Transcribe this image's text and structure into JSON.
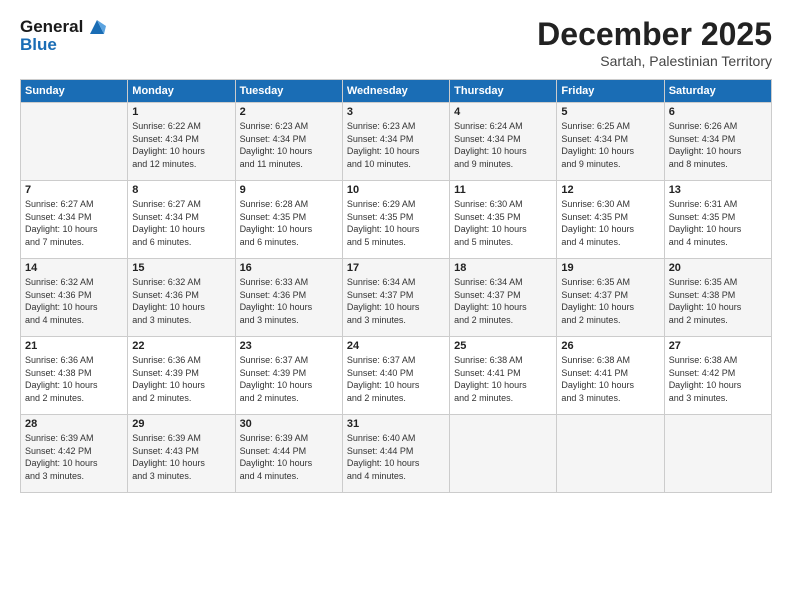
{
  "logo": {
    "line1": "General",
    "line2": "Blue"
  },
  "title": "December 2025",
  "subtitle": "Sartah, Palestinian Territory",
  "days_of_week": [
    "Sunday",
    "Monday",
    "Tuesday",
    "Wednesday",
    "Thursday",
    "Friday",
    "Saturday"
  ],
  "weeks": [
    [
      {
        "day": "",
        "info": ""
      },
      {
        "day": "1",
        "info": "Sunrise: 6:22 AM\nSunset: 4:34 PM\nDaylight: 10 hours\nand 12 minutes."
      },
      {
        "day": "2",
        "info": "Sunrise: 6:23 AM\nSunset: 4:34 PM\nDaylight: 10 hours\nand 11 minutes."
      },
      {
        "day": "3",
        "info": "Sunrise: 6:23 AM\nSunset: 4:34 PM\nDaylight: 10 hours\nand 10 minutes."
      },
      {
        "day": "4",
        "info": "Sunrise: 6:24 AM\nSunset: 4:34 PM\nDaylight: 10 hours\nand 9 minutes."
      },
      {
        "day": "5",
        "info": "Sunrise: 6:25 AM\nSunset: 4:34 PM\nDaylight: 10 hours\nand 9 minutes."
      },
      {
        "day": "6",
        "info": "Sunrise: 6:26 AM\nSunset: 4:34 PM\nDaylight: 10 hours\nand 8 minutes."
      }
    ],
    [
      {
        "day": "7",
        "info": "Sunrise: 6:27 AM\nSunset: 4:34 PM\nDaylight: 10 hours\nand 7 minutes."
      },
      {
        "day": "8",
        "info": "Sunrise: 6:27 AM\nSunset: 4:34 PM\nDaylight: 10 hours\nand 6 minutes."
      },
      {
        "day": "9",
        "info": "Sunrise: 6:28 AM\nSunset: 4:35 PM\nDaylight: 10 hours\nand 6 minutes."
      },
      {
        "day": "10",
        "info": "Sunrise: 6:29 AM\nSunset: 4:35 PM\nDaylight: 10 hours\nand 5 minutes."
      },
      {
        "day": "11",
        "info": "Sunrise: 6:30 AM\nSunset: 4:35 PM\nDaylight: 10 hours\nand 5 minutes."
      },
      {
        "day": "12",
        "info": "Sunrise: 6:30 AM\nSunset: 4:35 PM\nDaylight: 10 hours\nand 4 minutes."
      },
      {
        "day": "13",
        "info": "Sunrise: 6:31 AM\nSunset: 4:35 PM\nDaylight: 10 hours\nand 4 minutes."
      }
    ],
    [
      {
        "day": "14",
        "info": "Sunrise: 6:32 AM\nSunset: 4:36 PM\nDaylight: 10 hours\nand 4 minutes."
      },
      {
        "day": "15",
        "info": "Sunrise: 6:32 AM\nSunset: 4:36 PM\nDaylight: 10 hours\nand 3 minutes."
      },
      {
        "day": "16",
        "info": "Sunrise: 6:33 AM\nSunset: 4:36 PM\nDaylight: 10 hours\nand 3 minutes."
      },
      {
        "day": "17",
        "info": "Sunrise: 6:34 AM\nSunset: 4:37 PM\nDaylight: 10 hours\nand 3 minutes."
      },
      {
        "day": "18",
        "info": "Sunrise: 6:34 AM\nSunset: 4:37 PM\nDaylight: 10 hours\nand 2 minutes."
      },
      {
        "day": "19",
        "info": "Sunrise: 6:35 AM\nSunset: 4:37 PM\nDaylight: 10 hours\nand 2 minutes."
      },
      {
        "day": "20",
        "info": "Sunrise: 6:35 AM\nSunset: 4:38 PM\nDaylight: 10 hours\nand 2 minutes."
      }
    ],
    [
      {
        "day": "21",
        "info": "Sunrise: 6:36 AM\nSunset: 4:38 PM\nDaylight: 10 hours\nand 2 minutes."
      },
      {
        "day": "22",
        "info": "Sunrise: 6:36 AM\nSunset: 4:39 PM\nDaylight: 10 hours\nand 2 minutes."
      },
      {
        "day": "23",
        "info": "Sunrise: 6:37 AM\nSunset: 4:39 PM\nDaylight: 10 hours\nand 2 minutes."
      },
      {
        "day": "24",
        "info": "Sunrise: 6:37 AM\nSunset: 4:40 PM\nDaylight: 10 hours\nand 2 minutes."
      },
      {
        "day": "25",
        "info": "Sunrise: 6:38 AM\nSunset: 4:41 PM\nDaylight: 10 hours\nand 2 minutes."
      },
      {
        "day": "26",
        "info": "Sunrise: 6:38 AM\nSunset: 4:41 PM\nDaylight: 10 hours\nand 3 minutes."
      },
      {
        "day": "27",
        "info": "Sunrise: 6:38 AM\nSunset: 4:42 PM\nDaylight: 10 hours\nand 3 minutes."
      }
    ],
    [
      {
        "day": "28",
        "info": "Sunrise: 6:39 AM\nSunset: 4:42 PM\nDaylight: 10 hours\nand 3 minutes."
      },
      {
        "day": "29",
        "info": "Sunrise: 6:39 AM\nSunset: 4:43 PM\nDaylight: 10 hours\nand 3 minutes."
      },
      {
        "day": "30",
        "info": "Sunrise: 6:39 AM\nSunset: 4:44 PM\nDaylight: 10 hours\nand 4 minutes."
      },
      {
        "day": "31",
        "info": "Sunrise: 6:40 AM\nSunset: 4:44 PM\nDaylight: 10 hours\nand 4 minutes."
      },
      {
        "day": "",
        "info": ""
      },
      {
        "day": "",
        "info": ""
      },
      {
        "day": "",
        "info": ""
      }
    ]
  ]
}
